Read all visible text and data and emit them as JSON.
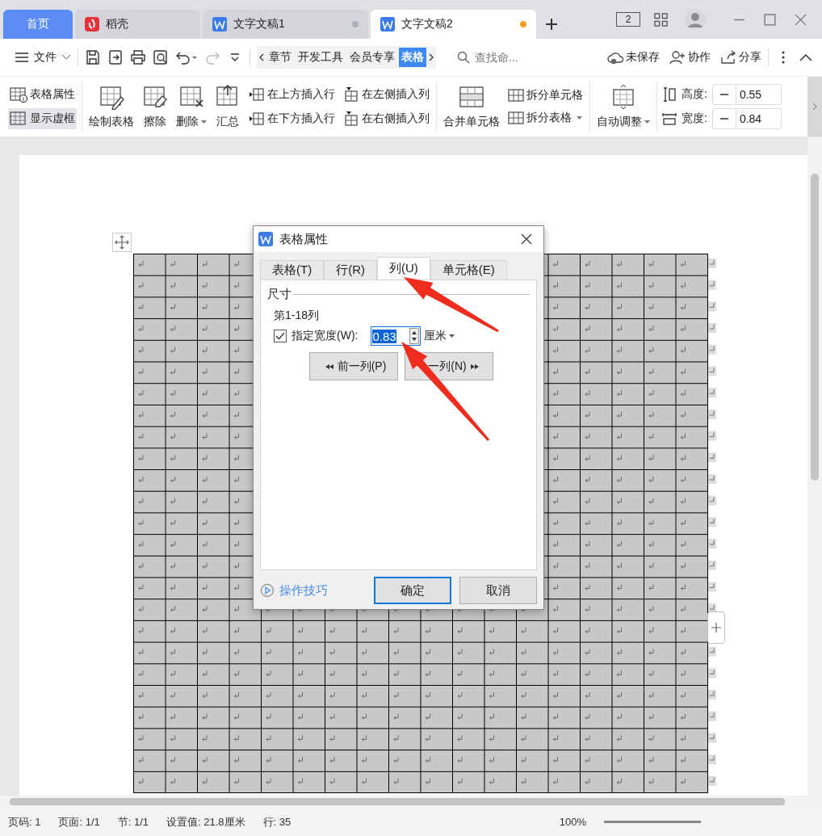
{
  "tabs": [
    {
      "label": "首页",
      "kind": "home",
      "selected": false,
      "unsaved": false
    },
    {
      "label": "稻壳",
      "kind": "docer",
      "selected": false,
      "unsaved": false
    },
    {
      "label": "文字文稿1",
      "kind": "doc",
      "selected": false,
      "unsaved": true
    },
    {
      "label": "文字文稿2",
      "kind": "doc",
      "selected": true,
      "unsaved": true
    }
  ],
  "window_count": "2",
  "toolbar": {
    "file_menu": "文件",
    "ribbon_tabs": [
      {
        "label": "章节",
        "selected": false
      },
      {
        "label": "开发工具",
        "selected": false
      },
      {
        "label": "会员专享",
        "selected": false
      },
      {
        "label": "表格",
        "selected": true
      }
    ],
    "search": {
      "placeholder": "查找命..."
    },
    "actions": [
      {
        "label": "未保存",
        "kind": "cloud"
      },
      {
        "label": "协作",
        "kind": "user"
      },
      {
        "label": "分享",
        "kind": "share"
      }
    ]
  },
  "ribbon": {
    "props": [
      {
        "label": "表格属性",
        "kind": "props",
        "active": false
      },
      {
        "label": "显示虚框",
        "kind": "grid",
        "active": true
      }
    ],
    "big": [
      {
        "label": "绘制表格",
        "kind": "draw",
        "dropdown": false
      },
      {
        "label": "擦除",
        "kind": "erase",
        "dropdown": false
      },
      {
        "label": "删除",
        "kind": "delete",
        "dropdown": true
      },
      {
        "label": "汇总",
        "kind": "sum",
        "dropdown": false
      }
    ],
    "insert": [
      {
        "label": "在上方插入行",
        "kind": "row"
      },
      {
        "label": "在左侧插入列",
        "kind": "col"
      },
      {
        "label": "在下方插入行",
        "kind": "row"
      },
      {
        "label": "在右侧插入列",
        "kind": "col"
      }
    ],
    "merge": {
      "label": "合并单元格"
    },
    "split": [
      {
        "label": "拆分单元格",
        "dropdown": false
      },
      {
        "label": "拆分表格",
        "dropdown": true
      }
    ],
    "autofit": {
      "label": "自动调整",
      "dropdown": true
    },
    "size": [
      {
        "label": "高度:",
        "kind": "height",
        "value": "0.55"
      },
      {
        "label": "宽度:",
        "kind": "width",
        "value": "0.84"
      }
    ]
  },
  "dialog": {
    "title": "表格属性",
    "tabs": [
      {
        "label": "表格(T)",
        "selected": false
      },
      {
        "label": "行(R)",
        "selected": false
      },
      {
        "label": "列(U)",
        "selected": true
      },
      {
        "label": "单元格(E)",
        "selected": false
      }
    ],
    "section": "尺寸",
    "range": "第1-18列",
    "width_option": {
      "label": "指定宽度(W):",
      "checked": true,
      "value": "0.83",
      "unit": "厘米"
    },
    "nav": [
      {
        "label": "前一列(P)",
        "kind": "prev"
      },
      {
        "label": "一列(N)",
        "kind": "next"
      }
    ],
    "tips": "操作技巧",
    "buttons": [
      {
        "label": "确定",
        "default": true
      },
      {
        "label": "取消",
        "default": false
      }
    ]
  },
  "status_bar": {
    "items": [
      "页码: 1",
      "页面: 1/1",
      "节: 1/1",
      "设置值: 21.8厘米",
      "行: 35"
    ],
    "zoom": "100%"
  }
}
